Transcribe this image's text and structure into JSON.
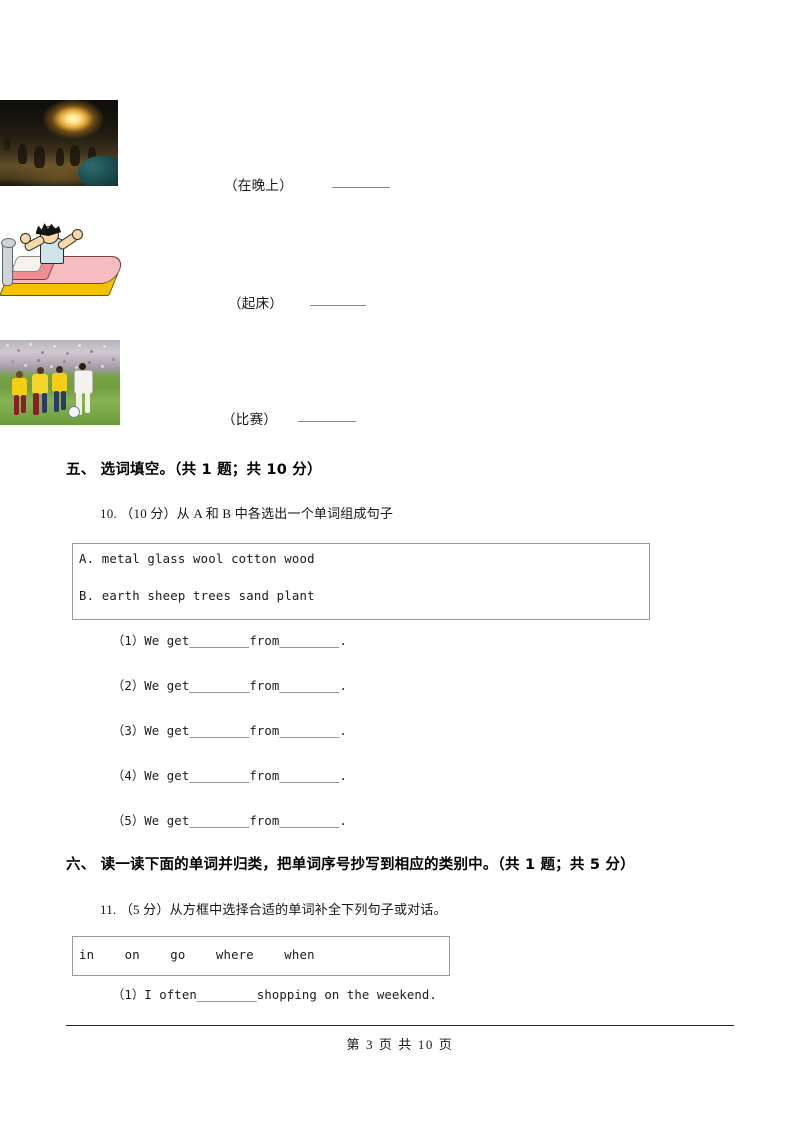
{
  "document": {
    "page_label": "第 3 页 共 10 页",
    "page_number": 3,
    "total_pages": 10
  },
  "picture_items": [
    {
      "image_name": "night-street-photo",
      "image_alt": "夜晚街道灯光照片",
      "label": "（在晚上）",
      "answer_value": ""
    },
    {
      "image_name": "wake-up-cartoon",
      "image_alt": "卡通人物起床伸懒腰",
      "label": "（起床）",
      "answer_value": ""
    },
    {
      "image_name": "soccer-match-photo",
      "image_alt": "足球比赛照片",
      "label": "（比赛）",
      "answer_value": ""
    }
  ],
  "sections": [
    {
      "heading": "五、 选词填空。（共 1 题；共 10 分）",
      "question": {
        "stem": "10.  （10 分）从 A 和 B 中各选出一个单词组成句子",
        "word_box": [
          "A. metal glass wool cotton wood",
          "B. earth sheep trees sand plant"
        ],
        "items": [
          "（1）We get________from________.",
          "（2）We get________from________.",
          "（3）We get________from________.",
          "（4）We get________from________.",
          "（5）We get________from________."
        ]
      }
    },
    {
      "heading": "六、 读一读下面的单词并归类，把单词序号抄写到相应的类别中。（共 1 题；共 5 分）",
      "question": {
        "stem": "11.  （5 分）从方框中选择合适的单词补全下列句子或对话。",
        "word_box": [
          "in    on    go    where    when"
        ],
        "items": [
          "（1）I often________shopping on the weekend."
        ]
      }
    }
  ]
}
